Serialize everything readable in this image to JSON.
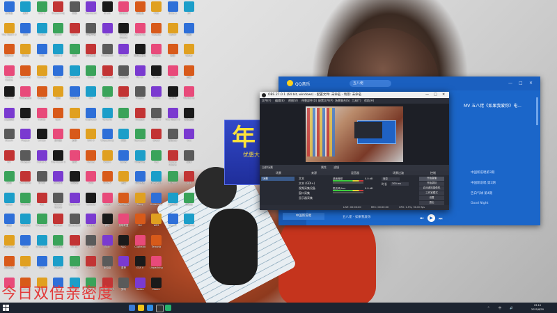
{
  "desktop": {
    "icons": [
      "此电脑",
      "The Room 3",
      "腾讯QQ",
      "Goose Goose",
      "Hitman",
      "大型游戏",
      "Steam",
      "EA",
      "网络",
      "Uplay",
      "迅雷",
      "WeGame",
      "英雄联盟",
      "VLC",
      "原神",
      "剪映",
      "回收站",
      "Spelunky",
      "网易云音乐",
      "Mirror",
      "Plague",
      "Oxygen",
      "Teardown",
      "哔哩哔哩",
      "控制面板",
      "Stray",
      "Ori",
      "Cuphead",
      "GTA V",
      "Hades",
      "OBS",
      "Celeste",
      "QQ音乐",
      "Inside",
      "Limbo",
      "Portal 2",
      "Braid",
      "Fez",
      "Firewatch",
      "Undertale",
      "WPS",
      "Terraria",
      "Unpacking",
      "Doom",
      "Dota 2",
      "CSGO",
      "微信",
      "Epic"
    ]
  },
  "promo": {
    "big": "年",
    "small": "优惠大"
  },
  "qq_music": {
    "app_name": "QQ音乐",
    "search": "五八佬",
    "song_title": "MV  五八佬《如果我爱你》电...",
    "rows": [
      "Good Night",
      "中国新说唱第3期",
      "中国新说唱 第2期",
      "告白气球 第4期"
    ],
    "player_info": "五八佬 - 如果我爱你",
    "bottom_tab": "中国新说唱",
    "window_controls": [
      "—",
      "□",
      "✕"
    ]
  },
  "obs": {
    "title": "OBS 27.0.1 (64 bit, windows) - 配置文件: 未命名 - 场景: 未命名",
    "window_controls": [
      "—",
      "□",
      "✕"
    ],
    "menu": [
      "文件(F)",
      "编辑(E)",
      "视图(V)",
      "停靠部件(D)",
      "配置文件(P)",
      "场景集合(S)",
      "工具(T)",
      "帮助(H)"
    ],
    "toolbar": [
      "当前场景",
      "属性",
      "滤镜"
    ],
    "docks": {
      "scenes": "场景",
      "sources": "来源",
      "mixer": "混音器",
      "transitions": "场景过渡",
      "controls": "控制"
    },
    "scene_name": "场景",
    "sources": [
      "文本",
      "文本 (GDI+)",
      "视频采集设备",
      "窗口采集",
      "显示器采集"
    ],
    "mixer": [
      {
        "name": "桌面音频",
        "db": "0.0 dB"
      },
      {
        "name": "麦克风/Aux",
        "db": "0.0 dB"
      }
    ],
    "transition": {
      "type": "渐变",
      "duration_label": "时长",
      "duration": "300 ms"
    },
    "controls": [
      "开始直播",
      "开始录制",
      "启动虚拟摄像机",
      "工作室模式",
      "设置",
      "退出"
    ],
    "status": {
      "live": "LIVE: 00:00:00",
      "rec": "REC: 00:00:00",
      "cpu": "CPU: 1.5%, 30.00 fps"
    }
  },
  "overlay_text": "今日双倍亲密度",
  "taskbar": {
    "tray": [
      "^",
      "中",
      "🔊"
    ],
    "time": "23:10",
    "date": "2021/8/20"
  }
}
